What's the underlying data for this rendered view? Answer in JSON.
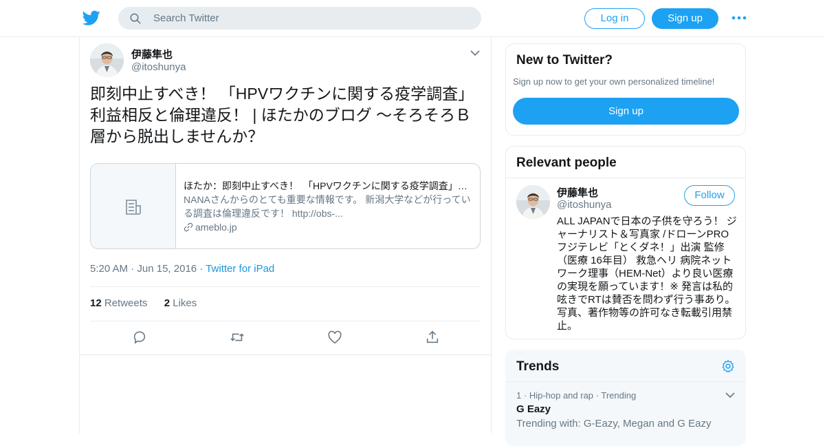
{
  "header": {
    "search_placeholder": "Search Twitter",
    "login_label": "Log in",
    "signup_label": "Sign up"
  },
  "tweet": {
    "author_name": "伊藤隼也",
    "author_handle": "@itoshunya",
    "text": "即刻中止すべき！ 「HPVワクチンに関する疫学調査」利益相反と倫理違反！ | ほたかのブログ ～そろそろＢ層から脱出しませんか？",
    "card": {
      "title": "ほたか：即刻中止すべき！　「HPVワクチンに関する疫学調査」利益相反と倫理違反！",
      "description": "NANAさんからのとても重要な情報です。 新潟大学などが行っている調査は倫理違反です！ http://obs-...",
      "domain": "ameblo.jp"
    },
    "time": "5:20 AM",
    "date": "Jun 15, 2016",
    "source": "Twitter for iPad",
    "retweets_count": "12",
    "retweets_label": "Retweets",
    "likes_count": "2",
    "likes_label": "Likes"
  },
  "sidebar": {
    "new_to_twitter": {
      "title": "New to Twitter?",
      "subtitle": "Sign up now to get your own personalized timeline!",
      "button_label": "Sign up"
    },
    "relevant_people": {
      "title": "Relevant people",
      "person": {
        "name": "伊藤隼也",
        "handle": "@itoshunya",
        "follow_label": "Follow",
        "bio": "ALL JAPANで日本の子供を守ろう！ ジャーナリスト＆写真家 /ドローンPRO フジテレビ「とくダネ！」出演 監修（医療 16年目） 救急ヘリ 病院ネットワーク理事（HEM-Net）より良い医療の実現を願っています！※ 発言は私的呟きでRTは賛否を問わず行う事あり。写真、著作物等の許可なき転載引用禁止。"
      }
    },
    "trends": {
      "title": "Trends",
      "items": [
        {
          "rank": "1",
          "category": "Hip-hop and rap",
          "status": "Trending",
          "name": "G Eazy",
          "trending_with": "Trending with: G-Eazy, Megan and G Eazy"
        }
      ]
    }
  },
  "colors": {
    "accent": "#1da1f2",
    "secondary_text": "#657786",
    "border": "#e6ecf0"
  },
  "icons": {
    "logo": "twitter-bird-icon",
    "search": "search-icon",
    "more": "more-dots-icon",
    "caret": "chevron-down-icon",
    "card": "document-icon",
    "link": "link-icon",
    "reply": "reply-icon",
    "retweet": "retweet-icon",
    "like": "heart-icon",
    "share": "share-icon",
    "settings": "gear-icon"
  }
}
